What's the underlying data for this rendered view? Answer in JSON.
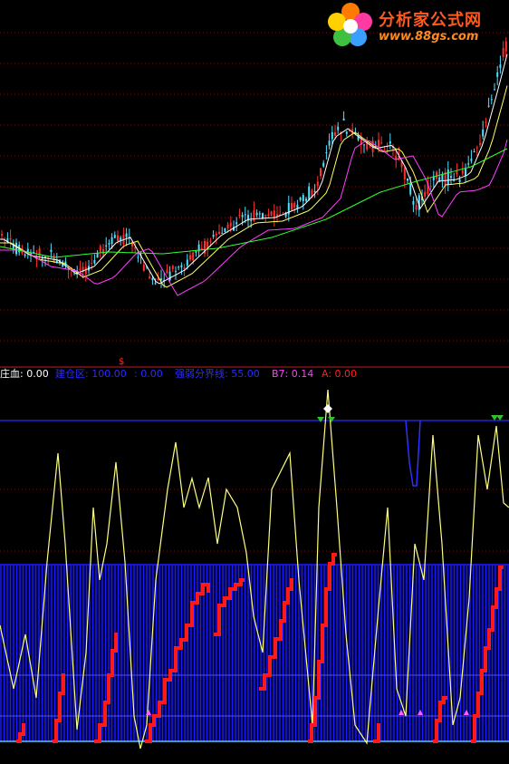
{
  "logo": {
    "name": "分析家公式网",
    "url": "www.88gs.com"
  },
  "legend": [
    {
      "label": "庄血",
      "value": "0.00",
      "color": "#ffffff"
    },
    {
      "label": "建仓区",
      "value": "100.00",
      "color": "#2a2aff"
    },
    {
      "label": "",
      "value": "0.00",
      "color": "#2a2aff"
    },
    {
      "label": "强弱分界线",
      "value": "55.00",
      "color": "#2a2aff"
    },
    {
      "label": "B7",
      "value": "0.14",
      "color": "#ff40ff"
    },
    {
      "label": "A",
      "value": "0.00",
      "color": "#ff2020"
    }
  ],
  "colors": {
    "up_candle": "#ff3030",
    "down_candle": "#50e0ff",
    "ma_short": "#ffffff",
    "ma_mid": "#ffff66",
    "ma_long": "#ff40ff",
    "ma_longest": "#30ff30",
    "oscillator": "#ffff80",
    "zone_fill": "#1a1aff",
    "buy_marker": "#30c030",
    "top_marker": "#ffffff"
  },
  "chart_data": {
    "type": "line",
    "title": "",
    "panels": [
      {
        "name": "price",
        "content": "candlestick with moving averages",
        "note": "no axis labels visible"
      },
      {
        "name": "indicator",
        "lines": [
          {
            "name": "强弱分界线",
            "value": 55.0
          },
          {
            "name": "建仓区",
            "value": 100.0
          }
        ]
      }
    ]
  }
}
